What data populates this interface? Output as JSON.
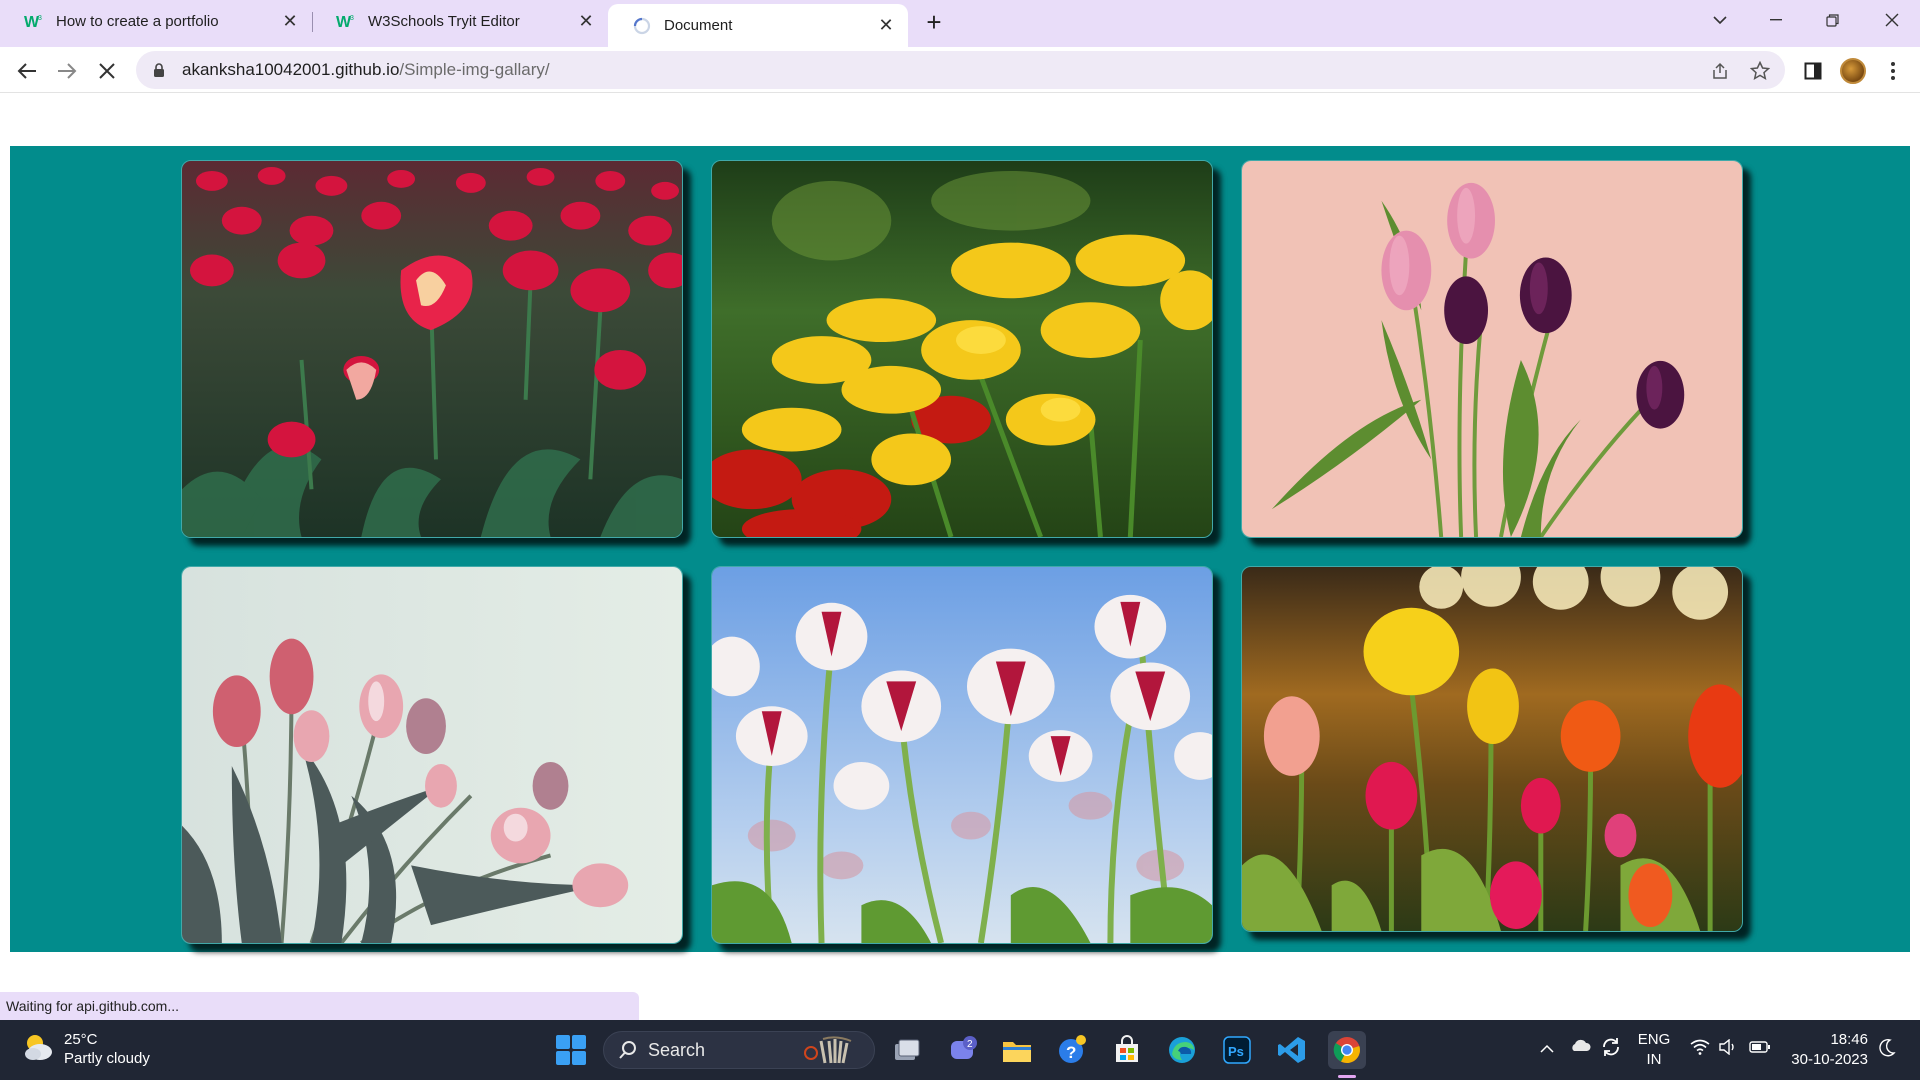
{
  "browser": {
    "tabs": [
      {
        "title": "How to create a portfolio",
        "favicon": "w3schools-icon",
        "active": false
      },
      {
        "title": "W3Schools Tryit Editor",
        "favicon": "w3schools-icon",
        "active": false
      },
      {
        "title": "Document",
        "favicon": "loading-icon",
        "active": true
      }
    ],
    "address": {
      "domain": "akanksha10042001.github.io",
      "path": "/Simple-img-gallary/"
    },
    "status_text": "Waiting for api.github.com..."
  },
  "gallery": {
    "background": "#028c8c",
    "images": [
      {
        "subject": "red-white-tulip-field"
      },
      {
        "subject": "yellow-tulips-blurred-green"
      },
      {
        "subject": "pink-purple-tulips-pink-background"
      },
      {
        "subject": "pale-pink-tulips-bouquet"
      },
      {
        "subject": "red-white-tulips-blue-sky"
      },
      {
        "subject": "colorful-tulips-sunset"
      }
    ]
  },
  "taskbar": {
    "weather": {
      "temp": "25°C",
      "condition": "Partly cloudy"
    },
    "search_label": "Search",
    "notification_badge": "2",
    "language": {
      "line1": "ENG",
      "line2": "IN"
    },
    "time": "18:46",
    "date": "30-10-2023"
  },
  "colors": {
    "tabbar": "#e9ddf9",
    "taskbar": "#202634",
    "accent": "#028c8c"
  }
}
